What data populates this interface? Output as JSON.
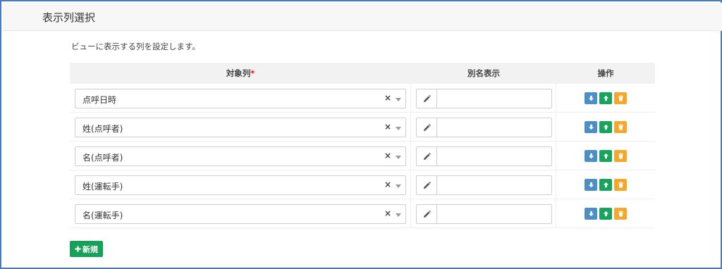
{
  "header": {
    "title": "表示列選択"
  },
  "description": "ビューに表示する列を設定します。",
  "table": {
    "headers": {
      "column": "対象列",
      "required_mark": "*",
      "alias": "別名表示",
      "ops": "操作"
    },
    "rows": [
      {
        "column": "点呼日時",
        "alias": ""
      },
      {
        "column": "姓(点呼者)",
        "alias": ""
      },
      {
        "column": "名(点呼者)",
        "alias": ""
      },
      {
        "column": "姓(運転手)",
        "alias": ""
      },
      {
        "column": "名(運転手)",
        "alias": ""
      }
    ],
    "clear_glyph": "×"
  },
  "new_button": {
    "icon": "plus-icon",
    "label": "新規"
  },
  "colors": {
    "frame": "#4a7ab8",
    "down": "#4b8fc6",
    "up": "#1aa35c",
    "delete": "#f4a72a",
    "new": "#17a05a",
    "required": "#e02020"
  }
}
